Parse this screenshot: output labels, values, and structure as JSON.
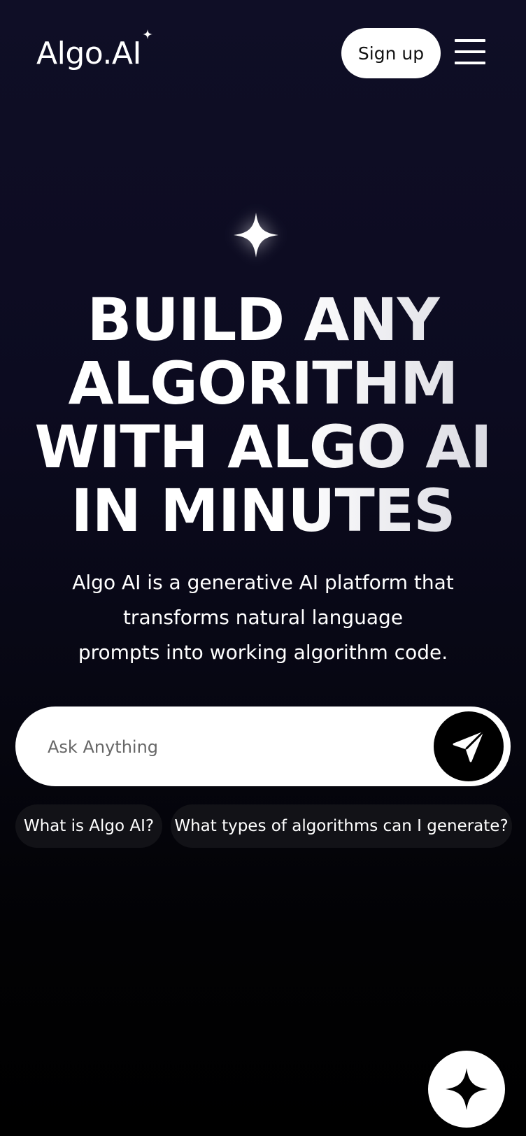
{
  "header": {
    "logo_text": "Algo.AI",
    "logo_icon": "sparkle-icon",
    "signup_label": "Sign up",
    "menu_icon": "hamburger-menu-icon"
  },
  "hero": {
    "icon": "sparkle-icon",
    "headline_lines": [
      "BUILD ANY",
      "ALGORITHM",
      "WITH ALGO AI",
      "IN MINUTES"
    ],
    "subtitle_lines": [
      "Algo AI is a generative AI platform that",
      "transforms natural language",
      "prompts into working algorithm code."
    ]
  },
  "search": {
    "placeholder": "Ask Anything",
    "value": "",
    "send_icon": "send-icon"
  },
  "suggestions": [
    "What is Algo AI?",
    "What types of algorithms can I generate?"
  ],
  "fab": {
    "icon": "sparkle-icon"
  },
  "colors": {
    "background_top": "#0f0e26",
    "background_bottom": "#000000",
    "primary": "#ffffff",
    "chip_background": "#121217"
  }
}
